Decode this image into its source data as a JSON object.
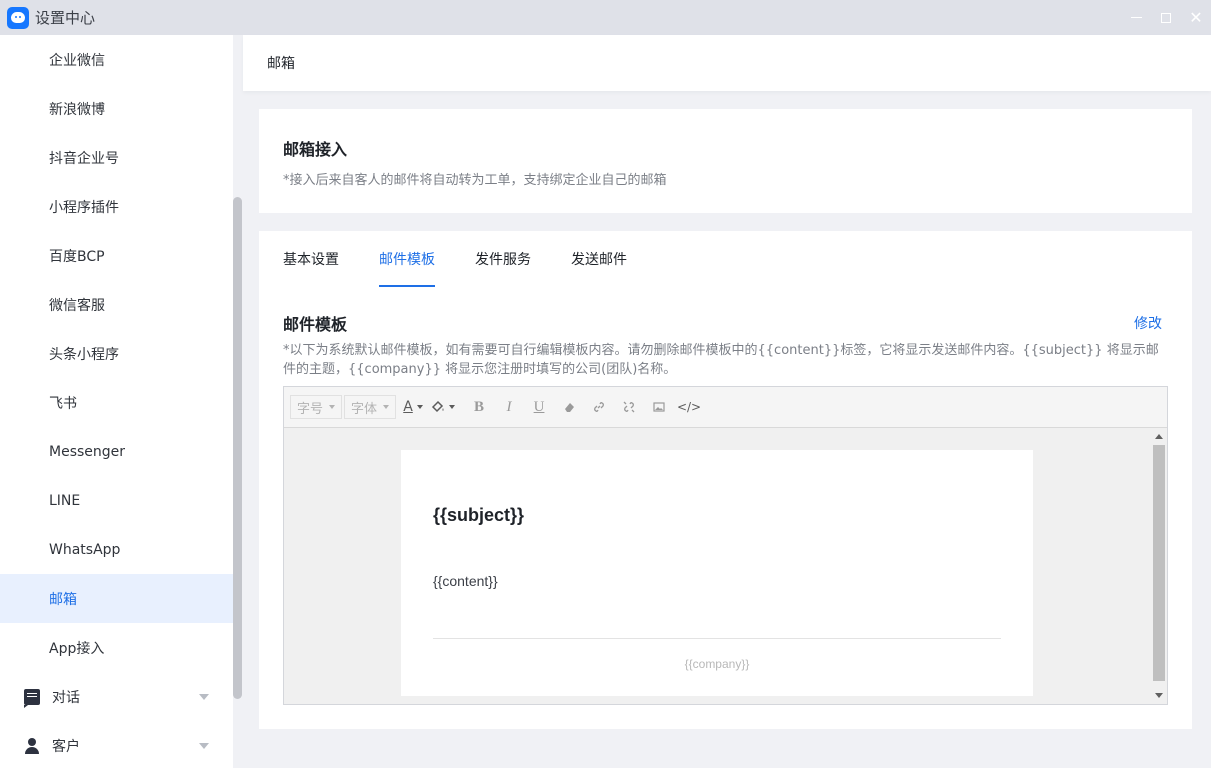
{
  "window": {
    "title": "设置中心",
    "icons": [
      "app-logo",
      "minimize-icon",
      "maximize-icon",
      "close-icon"
    ]
  },
  "sidebar": {
    "items": [
      {
        "label": "企业微信"
      },
      {
        "label": "新浪微博"
      },
      {
        "label": "抖音企业号"
      },
      {
        "label": "小程序插件"
      },
      {
        "label": "百度BCP"
      },
      {
        "label": "微信客服"
      },
      {
        "label": "头条小程序"
      },
      {
        "label": "飞书"
      },
      {
        "label": "Messenger"
      },
      {
        "label": "LINE"
      },
      {
        "label": "WhatsApp"
      },
      {
        "label": "邮箱",
        "active": true
      },
      {
        "label": "App接入"
      }
    ],
    "groups": [
      {
        "label": "对话",
        "icon": "chat-icon"
      },
      {
        "label": "客户",
        "icon": "user-icon"
      }
    ]
  },
  "header": {
    "title": "邮箱"
  },
  "intro": {
    "title": "邮箱接入",
    "desc": "*接入后来自客人的邮件将自动转为工单，支持绑定企业自己的邮箱"
  },
  "tabs": [
    {
      "label": "基本设置"
    },
    {
      "label": "邮件模板",
      "active": true
    },
    {
      "label": "发件服务"
    },
    {
      "label": "发送邮件"
    }
  ],
  "template": {
    "title": "邮件模板",
    "edit_label": "修改",
    "desc": "*以下为系统默认邮件模板，如有需要可自行编辑模板内容。请勿删除邮件模板中的{{content}}标签，它将显示发送邮件内容。{{subject}} 将显示邮件的主题，{{company}} 将显示您注册时填写的公司(团队)名称。"
  },
  "editor": {
    "toolbar": {
      "font_size": "字号",
      "font_family": "字体",
      "text_color_glyph": "A",
      "bold_glyph": "B",
      "italic_glyph": "I",
      "underline_glyph": "U",
      "code_glyph": "</>",
      "icons": [
        "text-color-icon",
        "bg-color-icon",
        "bold-icon",
        "italic-icon",
        "underline-icon",
        "eraser-icon",
        "link-icon",
        "unlink-icon",
        "image-icon",
        "code-icon"
      ]
    },
    "subject": "{{subject}}",
    "content": "{{content}}",
    "company": "{{company}}"
  },
  "colors": {
    "accent": "#1e6fe6",
    "active_bg": "#e8f0fe",
    "titlebar": "#dfe1e8"
  }
}
